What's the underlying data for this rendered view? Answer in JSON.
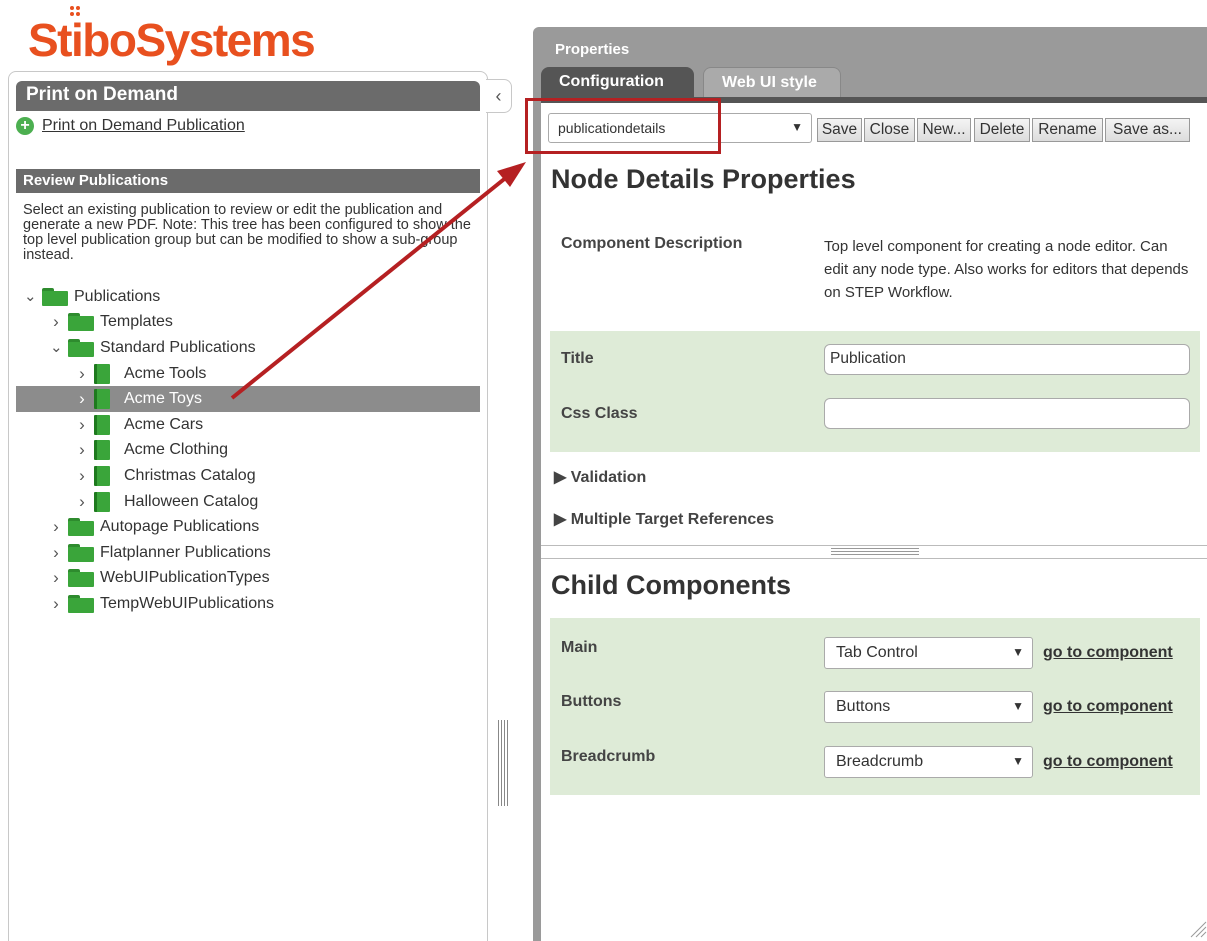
{
  "logo": {
    "text": "StiboSystems"
  },
  "left_panel": {
    "header": "Print on Demand",
    "collapse_icon": "chevron-left-icon",
    "create_link": "Print on Demand Publication",
    "review_header": "Review Publications",
    "review_description": "Select an existing publication to review or edit the publication and generate a new PDF. Note: This tree has been configured to show the top level publication group but can be modified to show a sub-group instead.",
    "tree": [
      {
        "label": "Publications",
        "level": 0,
        "expanded": true,
        "type": "folder"
      },
      {
        "label": "Templates",
        "level": 1,
        "expanded": false,
        "type": "folder"
      },
      {
        "label": "Standard Publications",
        "level": 1,
        "expanded": true,
        "type": "folder"
      },
      {
        "label": "Acme Tools",
        "level": 2,
        "expanded": false,
        "type": "book"
      },
      {
        "label": "Acme Toys",
        "level": 2,
        "expanded": false,
        "type": "book",
        "selected": true
      },
      {
        "label": "Acme Cars",
        "level": 2,
        "expanded": false,
        "type": "book"
      },
      {
        "label": "Acme Clothing",
        "level": 2,
        "expanded": false,
        "type": "book"
      },
      {
        "label": "Christmas Catalog",
        "level": 2,
        "expanded": false,
        "type": "book"
      },
      {
        "label": "Halloween Catalog",
        "level": 2,
        "expanded": false,
        "type": "book"
      },
      {
        "label": "Autopage Publications",
        "level": 1,
        "expanded": false,
        "type": "folder"
      },
      {
        "label": "Flatplanner Publications",
        "level": 1,
        "expanded": false,
        "type": "folder"
      },
      {
        "label": "WebUIPublicationTypes",
        "level": 1,
        "expanded": false,
        "type": "folder"
      },
      {
        "label": "TempWebUIPublications",
        "level": 1,
        "expanded": false,
        "type": "folder"
      }
    ]
  },
  "properties": {
    "title": "Properties",
    "tabs": [
      {
        "label": "Configuration",
        "active": true
      },
      {
        "label": "Web UI style",
        "active": false
      }
    ],
    "toolbar": {
      "select_value": "publicationdetails",
      "buttons": [
        "Save",
        "Close",
        "New...",
        "Delete",
        "Rename",
        "Save as..."
      ]
    },
    "node_details": {
      "title": "Node Details Properties",
      "component_description_label": "Component Description",
      "component_description_text": "Top level component for creating a node editor. Can edit any node type. Also works for editors that depends on STEP Workflow.",
      "title_label": "Title",
      "title_value": "Publication",
      "css_class_label": "Css Class",
      "css_class_value": "",
      "validation_label": "Validation",
      "multiple_target_label": "Multiple Target References"
    },
    "child_components": {
      "title": "Child Components",
      "rows": [
        {
          "label": "Main",
          "value": "Tab Control",
          "link": "go to component"
        },
        {
          "label": "Buttons",
          "value": "Buttons",
          "link": "go to component"
        },
        {
          "label": "Breadcrumb",
          "value": "Breadcrumb",
          "link": "go to component"
        }
      ]
    }
  },
  "colors": {
    "brand": "#e8501f",
    "header_gray": "#6b6b6b",
    "panel_gray": "#9a9a9a",
    "tab_active": "#555555",
    "green_bg": "#deebd7",
    "folder_green": "#3aa53a",
    "callout_red": "#b52022"
  }
}
